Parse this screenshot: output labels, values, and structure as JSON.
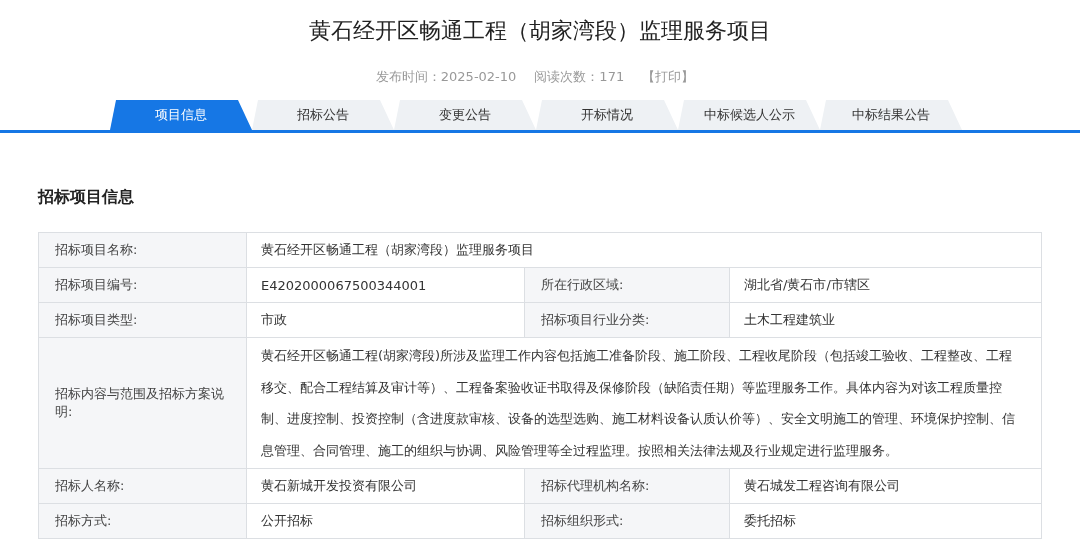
{
  "title": "黄石经开区畅通工程（胡家湾段）监理服务项目",
  "meta": {
    "publish_time": "发布时间：2025-02-10",
    "read_count": "阅读次数：171",
    "print_link": "【打印】"
  },
  "tabs": [
    {
      "label": "项目信息",
      "selected": true
    },
    {
      "label": "招标公告",
      "selected": false
    },
    {
      "label": "变更公告",
      "selected": false
    },
    {
      "label": "开标情况",
      "selected": false
    },
    {
      "label": "中标候选人公示",
      "selected": false
    },
    {
      "label": "中标结果公告",
      "selected": false
    }
  ],
  "section_title": "招标项目信息",
  "table": {
    "rows": [
      {
        "cells": [
          {
            "label": "招标项目名称:",
            "value": "黄石经开区畅通工程（胡家湾段）监理服务项目"
          }
        ]
      },
      {
        "cells": [
          {
            "label": "招标项目编号:",
            "value": "E4202000067500344001"
          },
          {
            "label": "所在行政区域:",
            "value": "湖北省/黄石市/市辖区"
          }
        ]
      },
      {
        "cells": [
          {
            "label": "招标项目类型:",
            "value": "市政"
          },
          {
            "label": "招标项目行业分类:",
            "value": "土木工程建筑业"
          }
        ]
      },
      {
        "cells": [
          {
            "label": "招标内容与范围及招标方案说明:",
            "value": "黄石经开区畅通工程(胡家湾段)所涉及监理工作内容包括施工准备阶段、施工阶段、工程收尾阶段（包括竣工验收、工程整改、工程移交、配合工程结算及审计等）、工程备案验收证书取得及保修阶段（缺陷责任期）等监理服务工作。具体内容为对该工程质量控制、进度控制、投资控制（含进度款审核、设备的选型选购、施工材料设备认质认价等）、安全文明施工的管理、环境保护控制、信息管理、合同管理、施工的组织与协调、风险管理等全过程监理。按照相关法律法规及行业规定进行监理服务。"
          }
        ]
      },
      {
        "cells": [
          {
            "label": "招标人名称:",
            "value": "黄石新城开发投资有限公司"
          },
          {
            "label": "招标代理机构名称:",
            "value": "黄石城发工程咨询有限公司"
          }
        ]
      },
      {
        "cells": [
          {
            "label": "招标方式:",
            "value": "公开招标"
          },
          {
            "label": "招标组织形式:",
            "value": "委托招标"
          }
        ]
      }
    ]
  }
}
